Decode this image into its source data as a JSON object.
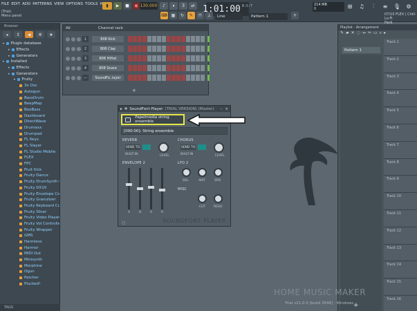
{
  "menu": [
    "FILE",
    "EDIT",
    "ADD",
    "PATTERNS",
    "VIEW",
    "OPTIONS",
    "TOOLS",
    "HELP"
  ],
  "hint": {
    "line1": "(Trial)",
    "line2": "Menu panel"
  },
  "transport": {
    "tempo": "130.000",
    "time": "1:01:00",
    "time_unit": "B:S:T",
    "line_mode": "Line",
    "pattern": "Pattern 1"
  },
  "cpu": {
    "mem": "214 MB",
    "poly": "0"
  },
  "news": {
    "line1": "07/10  FLEX | Chill-Lo-Fi",
    "line2": "Pack"
  },
  "browser": {
    "title": "Browser",
    "items": [
      {
        "label": "Plugin database",
        "level": 0,
        "kind": "folder"
      },
      {
        "label": "Effects",
        "level": 1,
        "kind": "folder"
      },
      {
        "label": "Generators",
        "level": 1,
        "kind": "folder"
      },
      {
        "label": "Installed",
        "level": 0,
        "kind": "folder"
      },
      {
        "label": "Effects",
        "level": 1,
        "kind": "folder"
      },
      {
        "label": "Generators",
        "level": 1,
        "kind": "folder"
      },
      {
        "label": "Fruity",
        "level": 2,
        "kind": "folder"
      },
      {
        "label": "3x Osc",
        "level": 3,
        "kind": "plug"
      },
      {
        "label": "Autogun",
        "level": 3,
        "kind": "plug"
      },
      {
        "label": "BassDrum",
        "level": 3,
        "kind": "plug"
      },
      {
        "label": "BeepMap",
        "level": 3,
        "kind": "plug"
      },
      {
        "label": "BooBass",
        "level": 3,
        "kind": "plug"
      },
      {
        "label": "Dashboard",
        "level": 3,
        "kind": "plug"
      },
      {
        "label": "DirectWave",
        "level": 3,
        "kind": "plug"
      },
      {
        "label": "Drumaxx",
        "level": 3,
        "kind": "plug"
      },
      {
        "label": "Drumpad",
        "level": 3,
        "kind": "plug"
      },
      {
        "label": "FL Keys",
        "level": 3,
        "kind": "plug"
      },
      {
        "label": "FL Slayer",
        "level": 3,
        "kind": "plug"
      },
      {
        "label": "FL Studio Mobile",
        "level": 3,
        "kind": "plug"
      },
      {
        "label": "FLEX",
        "level": 3,
        "kind": "plug"
      },
      {
        "label": "FPC",
        "level": 3,
        "kind": "plug"
      },
      {
        "label": "Fruit Kick",
        "level": 3,
        "kind": "plug"
      },
      {
        "label": "Fruity Dance",
        "level": 3,
        "kind": "plug"
      },
      {
        "label": "Fruity DrumSynth Live",
        "level": 3,
        "kind": "plug"
      },
      {
        "label": "Fruity DX10",
        "level": 3,
        "kind": "plug"
      },
      {
        "label": "Fruity Envelope Controller",
        "level": 3,
        "kind": "plug"
      },
      {
        "label": "Fruity Granulizer",
        "level": 3,
        "kind": "plug"
      },
      {
        "label": "Fruity Keyboard Controller",
        "level": 3,
        "kind": "plug"
      },
      {
        "label": "Fruity Slicer",
        "level": 3,
        "kind": "plug"
      },
      {
        "label": "Fruity Video Player",
        "level": 3,
        "kind": "plug"
      },
      {
        "label": "Fruity Vol Controller",
        "level": 3,
        "kind": "plug"
      },
      {
        "label": "Fruity Wrapper",
        "level": 3,
        "kind": "plug"
      },
      {
        "label": "GMS",
        "level": 3,
        "kind": "plug"
      },
      {
        "label": "Harmless",
        "level": 3,
        "kind": "plug"
      },
      {
        "label": "Harmor",
        "level": 3,
        "kind": "plug"
      },
      {
        "label": "MIDI Out",
        "level": 3,
        "kind": "plug"
      },
      {
        "label": "Minisynth",
        "level": 3,
        "kind": "plug"
      },
      {
        "label": "Morphine",
        "level": 3,
        "kind": "plug"
      },
      {
        "label": "Ogun",
        "level": 3,
        "kind": "plug"
      },
      {
        "label": "Patcher",
        "level": 3,
        "kind": "plug"
      },
      {
        "label": "Plucked!",
        "level": 3,
        "kind": "plug"
      }
    ],
    "footer": "TAGS"
  },
  "channel_rack": {
    "title": "Channel rack",
    "filter": "All",
    "channels": [
      {
        "num": "1",
        "name": "808 Kick"
      },
      {
        "num": "2",
        "name": "808 Clap"
      },
      {
        "num": "3",
        "name": "808 HiHat"
      },
      {
        "num": "4",
        "name": "808 Snare"
      },
      {
        "num": "---",
        "name": "SoundFo..layer"
      }
    ],
    "add": "+"
  },
  "playlist": {
    "title": "Playlist - Arrangement",
    "pattern": "Pattern 1",
    "tracks": [
      "Track 1",
      "Track 2",
      "Track 3",
      "Track 4",
      "Track 5",
      "Track 6",
      "Track 7",
      "Track 8",
      "Track 9",
      "Track 10",
      "Track 11",
      "Track 12",
      "Track 13",
      "Track 14",
      "Track 15",
      "Track 16"
    ],
    "add": "+"
  },
  "soundfont": {
    "title": "SoundFont Player",
    "version": "(TRIAL VERSION) (Master)",
    "file": "Papelmedia string ensemble",
    "bank": "[000:00]: String ensemble",
    "reverb": "REVERB",
    "chorus": "CHORUS",
    "send_to": "SEND TO",
    "builtin": "BUILT-IN",
    "level": "LEVEL",
    "envelope": "ENVELOPE 2",
    "env_labels": [
      "A",
      "D",
      "S",
      "R"
    ],
    "lfo": "LFO 2",
    "lfo_labels": [
      "DEL",
      "AMT",
      "SPD"
    ],
    "misc": "MISC",
    "misc_labels": [
      "CUT",
      "RESO"
    ],
    "brand": "SOUNDFONT PLAYER"
  },
  "watermark": "HOME MUSIC MAKER",
  "build": "Trial v21.0.0 [build 3548] - Windows"
}
